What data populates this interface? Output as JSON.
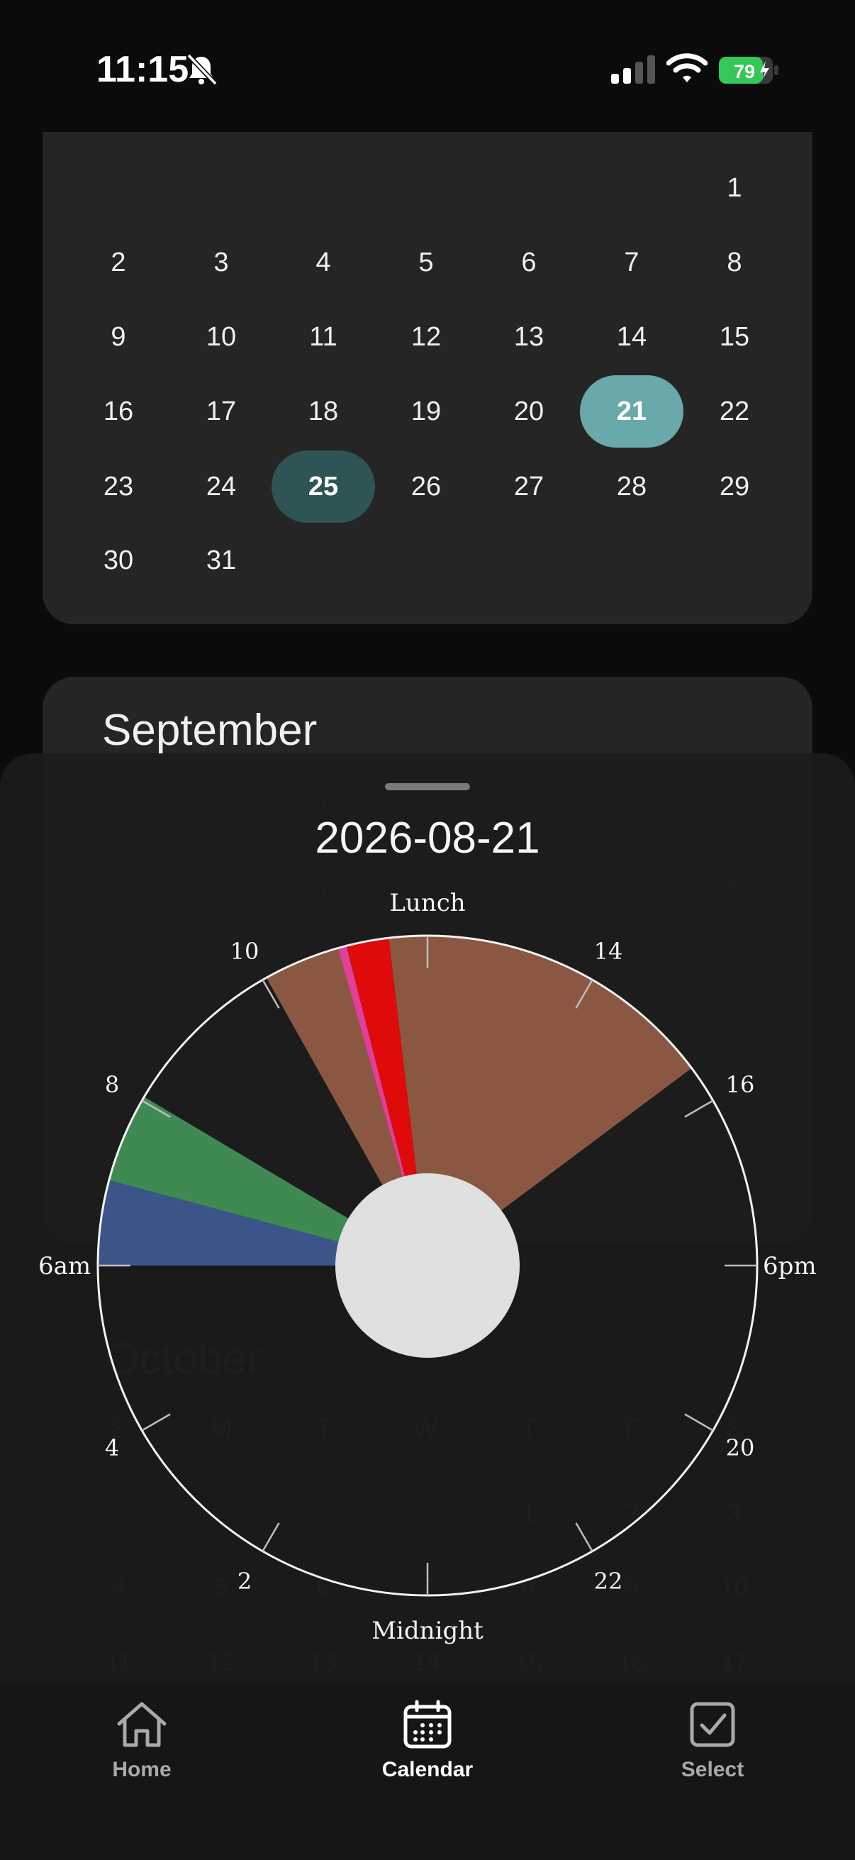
{
  "status": {
    "time": "11:15",
    "battery": "79"
  },
  "august": {
    "days": [
      [
        "",
        "",
        "",
        "",
        "",
        "",
        "1"
      ],
      [
        "2",
        "3",
        "4",
        "5",
        "6",
        "7",
        "8"
      ],
      [
        "9",
        "10",
        "11",
        "12",
        "13",
        "14",
        "15"
      ],
      [
        "16",
        "17",
        "18",
        "19",
        "20",
        "21",
        "22"
      ],
      [
        "23",
        "24",
        "25",
        "26",
        "27",
        "28",
        "29"
      ],
      [
        "30",
        "31",
        "",
        "",
        "",
        "",
        ""
      ]
    ],
    "selected_today": "21",
    "selected_other": "25"
  },
  "september": {
    "title": "September",
    "weekdays": [
      "S",
      "M",
      "T",
      "W",
      "T",
      "F",
      "S"
    ],
    "rows": [
      [
        "",
        "",
        "1",
        "2",
        "3",
        "4",
        "5"
      ],
      [
        "6",
        "7",
        "8",
        "9",
        "10",
        "11",
        "12"
      ],
      [
        "13",
        "14",
        "15",
        "16",
        "17",
        "18",
        "19"
      ],
      [
        "20",
        "21",
        "22",
        "23",
        "24",
        "25",
        "26"
      ],
      [
        "27",
        "28",
        "29",
        "30",
        "",
        "",
        ""
      ]
    ]
  },
  "october": {
    "title": "October",
    "weekdays": [
      "S",
      "M",
      "T",
      "W",
      "T",
      "F",
      "S"
    ],
    "rows": [
      [
        "",
        "",
        "",
        "",
        "1",
        "2",
        "3"
      ],
      [
        "4",
        "5",
        "6",
        "7",
        "8",
        "9",
        "10"
      ],
      [
        "11",
        "12",
        "13",
        "14",
        "15",
        "16",
        "17"
      ]
    ]
  },
  "sheet": {
    "date": "2026-08-21",
    "labels": {
      "top": "Lunch",
      "bottom": "Midnight",
      "left": "6am",
      "right": "6pm",
      "h10": "10",
      "h14": "14",
      "h8": "8",
      "h16": "16",
      "h4": "4",
      "h20": "20",
      "h2": "2",
      "h22": "22"
    },
    "segments_colors": {
      "brown": "#8a5842",
      "red": "#df0b0b",
      "pink": "#e0409a",
      "green": "#3f8a52",
      "blue": "#3b5588",
      "center": "#e0e0e0"
    }
  },
  "tabs": [
    {
      "label": "Home",
      "icon": "home-icon",
      "active": false
    },
    {
      "label": "Calendar",
      "icon": "calendar-icon",
      "active": true
    },
    {
      "label": "Select",
      "icon": "checkbox-icon",
      "active": false
    }
  ]
}
